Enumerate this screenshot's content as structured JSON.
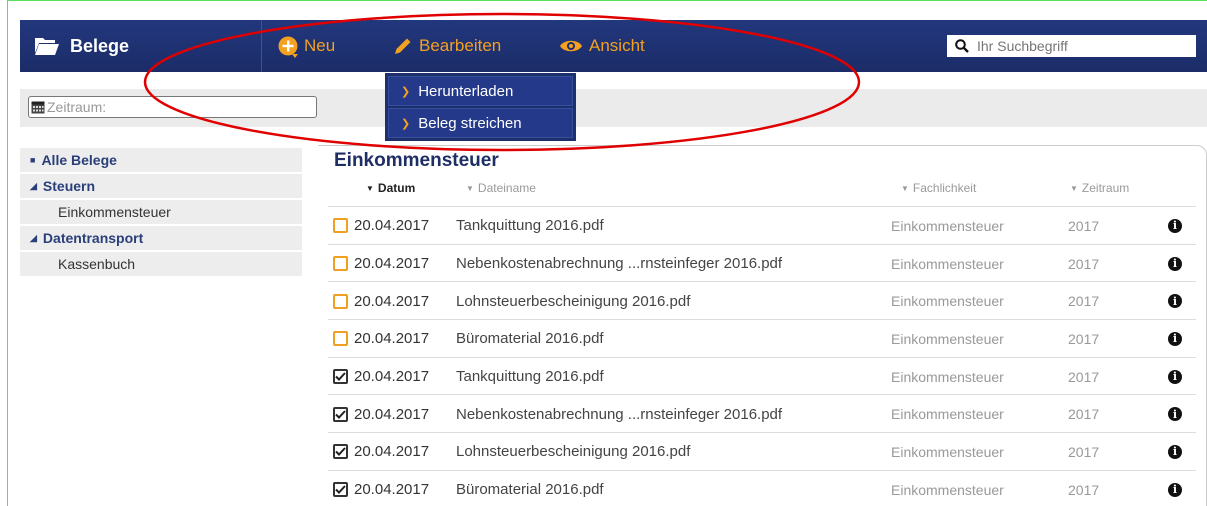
{
  "brand": {
    "title": "Belege"
  },
  "menu": {
    "neu": "Neu",
    "bearbeiten": "Bearbeiten",
    "ansicht": "Ansicht",
    "dropdown": [
      "Herunterladen",
      "Beleg streichen"
    ]
  },
  "search": {
    "placeholder": "Ihr Suchbegriff"
  },
  "filter": {
    "zeitraum_label": "Zeitraum:"
  },
  "sidebar": {
    "all": "Alle Belege",
    "steuern": "Steuern",
    "einkommensteuer": "Einkommensteuer",
    "datentransport": "Datentransport",
    "kassenbuch": "Kassenbuch"
  },
  "panel": {
    "title": "Einkommensteuer",
    "columns": {
      "datum": "Datum",
      "dateiname": "Dateiname",
      "fachlichkeit": "Fachlichkeit",
      "zeitraum": "Zeitraum"
    }
  },
  "rows": [
    {
      "checked": false,
      "date": "20.04.2017",
      "name": "Tankquittung 2016.pdf",
      "fach": "Einkommensteuer",
      "zeit": "2017"
    },
    {
      "checked": false,
      "date": "20.04.2017",
      "name": "Nebenkostenabrechnung ...rnsteinfeger 2016.pdf",
      "fach": "Einkommensteuer",
      "zeit": "2017"
    },
    {
      "checked": false,
      "date": "20.04.2017",
      "name": "Lohnsteuerbescheinigung 2016.pdf",
      "fach": "Einkommensteuer",
      "zeit": "2017"
    },
    {
      "checked": false,
      "date": "20.04.2017",
      "name": "Büromaterial 2016.pdf",
      "fach": "Einkommensteuer",
      "zeit": "2017"
    },
    {
      "checked": true,
      "date": "20.04.2017",
      "name": "Tankquittung 2016.pdf",
      "fach": "Einkommensteuer",
      "zeit": "2017"
    },
    {
      "checked": true,
      "date": "20.04.2017",
      "name": "Nebenkostenabrechnung ...rnsteinfeger 2016.pdf",
      "fach": "Einkommensteuer",
      "zeit": "2017"
    },
    {
      "checked": true,
      "date": "20.04.2017",
      "name": "Lohnsteuerbescheinigung 2016.pdf",
      "fach": "Einkommensteuer",
      "zeit": "2017"
    },
    {
      "checked": true,
      "date": "20.04.2017",
      "name": "Büromaterial 2016.pdf",
      "fach": "Einkommensteuer",
      "zeit": "2017"
    }
  ],
  "colors": {
    "nav": "#1f3170",
    "accent": "#f4a020",
    "annotation": "#e00000"
  }
}
